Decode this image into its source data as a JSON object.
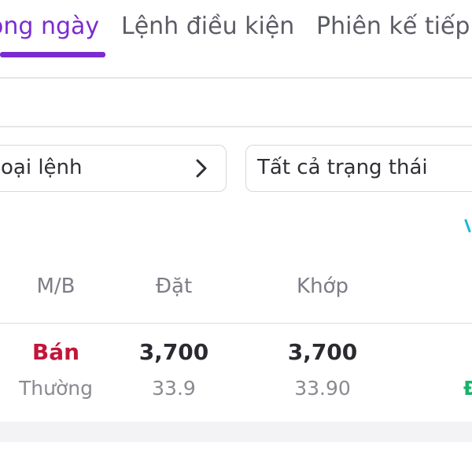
{
  "tabs": [
    {
      "label": "ong ngày",
      "active": true
    },
    {
      "label": "Lệnh điều kiện",
      "active": false
    },
    {
      "label": "Phiên kế tiếp",
      "active": false
    }
  ],
  "filters": {
    "order_type": "oại lệnh",
    "status": "Tất cả trạng thái"
  },
  "table": {
    "headers": [
      "M/B",
      "Đặt",
      "Khớp"
    ],
    "rows": [
      {
        "side": "Bán",
        "type": "Thường",
        "order_qty": "3,700",
        "order_price": "33.9",
        "match_qty": "3,700",
        "match_price": "33.90",
        "status": "Đ"
      }
    ]
  },
  "colors": {
    "accent": "#7b2cd1",
    "sell": "#c2153a",
    "status": "#18b36a",
    "edge_icon": "#1eb7d8"
  },
  "icons": {
    "filter_chevron": "chevron-right-icon",
    "edge_glyph": "cyan-glyph-icon"
  }
}
